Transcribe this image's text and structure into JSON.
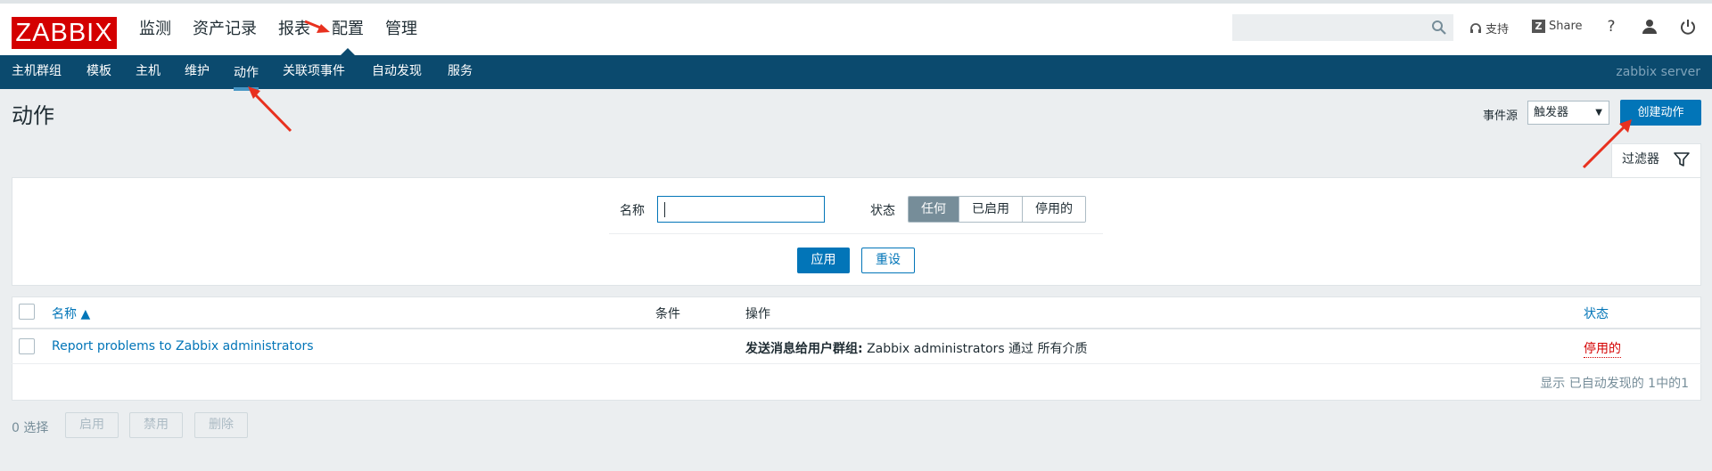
{
  "logo": "ZABBIX",
  "main_menu": [
    {
      "label": "监测",
      "selected": false
    },
    {
      "label": "资产记录",
      "selected": false
    },
    {
      "label": "报表",
      "selected": false
    },
    {
      "label": "配置",
      "selected": true
    },
    {
      "label": "管理",
      "selected": false
    }
  ],
  "header_links": {
    "support": "支持",
    "share": "Share",
    "help": "?"
  },
  "sub_menu": [
    {
      "label": "主机群组",
      "selected": false
    },
    {
      "label": "模板",
      "selected": false
    },
    {
      "label": "主机",
      "selected": false
    },
    {
      "label": "维护",
      "selected": false
    },
    {
      "label": "动作",
      "selected": true
    },
    {
      "label": "关联项事件",
      "selected": false
    },
    {
      "label": "自动发现",
      "selected": false
    },
    {
      "label": "服务",
      "selected": false
    }
  ],
  "server_name": "zabbix server",
  "page_title": "动作",
  "event_source": {
    "label": "事件源",
    "value": "触发器"
  },
  "create_button": "创建动作",
  "filter": {
    "tab_label": "过滤器",
    "name_label": "名称",
    "name_value": "",
    "status_label": "状态",
    "status_options": [
      "任何",
      "已启用",
      "停用的"
    ],
    "status_selected": "任何",
    "apply": "应用",
    "reset": "重设"
  },
  "table": {
    "columns": {
      "name": "名称 ▲",
      "conditions": "条件",
      "operations": "操作",
      "status": "状态"
    },
    "rows": [
      {
        "name": "Report problems to Zabbix administrators",
        "conditions": "",
        "operation_bold": "发送消息给用户群组:",
        "operation_rest": "Zabbix administrators 通过 所有介质",
        "status": "停用的"
      }
    ],
    "footer": "显示 已自动发现的 1中的1"
  },
  "bottom": {
    "selected_count": "0 选择",
    "enable": "启用",
    "disable": "禁用",
    "delete": "删除"
  },
  "colors": {
    "brand_red": "#d40000",
    "nav_blue": "#0b4a6e",
    "accent": "#0275b8",
    "status_disabled": "#d40000"
  }
}
